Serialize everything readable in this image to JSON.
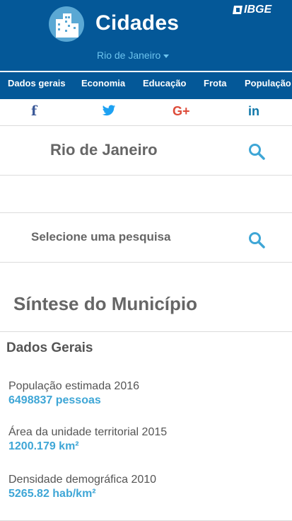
{
  "header": {
    "title": "Cidades",
    "logo_icon": "city-buildings-icon",
    "agency_logo": "IBGE",
    "city_selector": "Rio de Janeiro",
    "background": "#045898",
    "accent": "#6cc3ee"
  },
  "nav": {
    "items": [
      {
        "label": "Dados gerais"
      },
      {
        "label": "Economia"
      },
      {
        "label": "Educação"
      },
      {
        "label": "Frota"
      },
      {
        "label": "População"
      }
    ]
  },
  "social": {
    "icons": [
      "facebook-icon",
      "twitter-icon",
      "google-plus-icon",
      "linkedin-icon"
    ],
    "facebook": "f",
    "googleplus": "G+",
    "linkedin": "in"
  },
  "search": {
    "city_label": "Rio de Janeiro",
    "research_label": "Selecione uma pesquisa"
  },
  "main": {
    "title": "Síntese do Município",
    "section_title": "Dados Gerais",
    "stats": [
      {
        "name": "População estimada 2016",
        "value": "6498837 pessoas"
      },
      {
        "name": "Área da unidade territorial 2015",
        "value": "1200.179 km²"
      },
      {
        "name": "Densidade demográfica 2010",
        "value": "5265.82 hab/km²"
      }
    ],
    "value_color": "#3ea6d6"
  }
}
